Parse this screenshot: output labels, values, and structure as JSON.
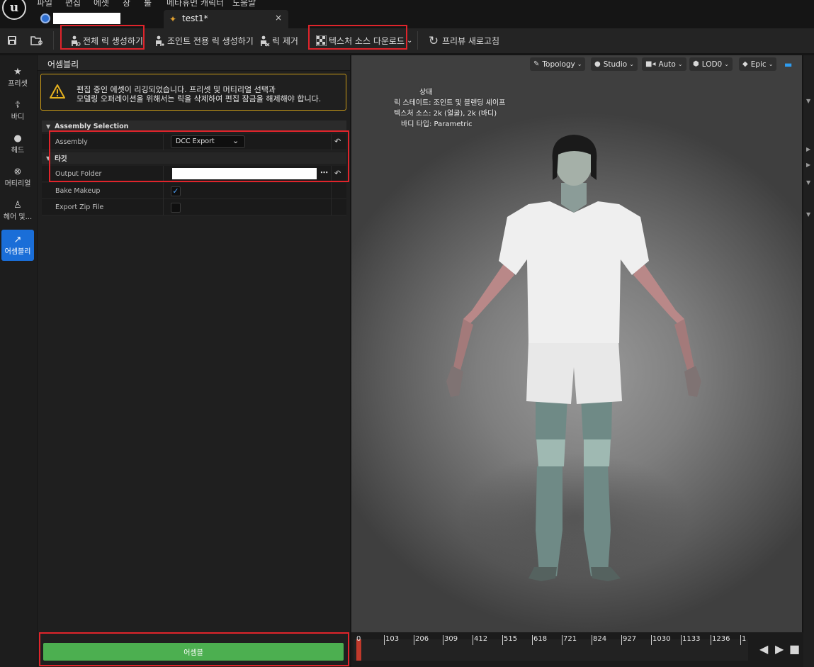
{
  "menu": {
    "items": [
      "파일",
      "편집",
      "에셋",
      "창",
      "툴",
      "메타휴먼 캐릭터",
      "도움말"
    ]
  },
  "tabs": {
    "document_label": "test1*",
    "close_glyph": "×"
  },
  "toolbar": {
    "rig_full_label": "전체 릭 생성하기",
    "rig_joint_label": "조인트 전용 릭 생성하기",
    "rig_remove_label": "릭 제거",
    "texture_download_label": "텍스처 소스 다운로드",
    "preview_refresh_label": "프리뷰 새로고침"
  },
  "leftnav": {
    "items": [
      {
        "label": "프리셋",
        "icon": "star-icon",
        "active": false
      },
      {
        "label": "바디",
        "icon": "body-icon",
        "active": false
      },
      {
        "label": "헤드",
        "icon": "head-icon",
        "active": false
      },
      {
        "label": "머티리얼",
        "icon": "material-icon",
        "active": false
      },
      {
        "label": "헤어 및...",
        "icon": "hair-icon",
        "active": false
      },
      {
        "label": "어셈블리",
        "icon": "hammer-icon",
        "active": true
      }
    ],
    "active_color": "#1a6ed8"
  },
  "panel": {
    "title": "어셈블리",
    "warning_line1": "편집 중인 에셋이 리깅되었습니다. 프리셋 및 머티리얼 선택과",
    "warning_line2": "모델링 오퍼레이션을 위해서는 릭을 삭제하여 편집 잠금을 해제해야 합니다.",
    "warning_color": "#c99a17",
    "section_assembly": "Assembly Selection",
    "section_target": "타깃",
    "assembly_label": "Assembly",
    "assembly_value": "DCC Export",
    "output_folder_label": "Output Folder",
    "bake_makeup_label": "Bake Makeup",
    "bake_makeup_checked": true,
    "export_zip_label": "Export Zip File",
    "export_zip_checked": false,
    "assemble_button": "어셈블",
    "assemble_color": "#4caf50"
  },
  "viewport": {
    "toolbar": [
      "Topology",
      "Studio",
      "Auto",
      "LOD0",
      "Epic"
    ],
    "status_title": "상태",
    "status_rig": "릭 스테이트: 조인트 및 블렌딩 셰이프",
    "status_texture": "텍스처 소스: 2k (얼굴), 2k (바디)",
    "status_body": "바디 타입: Parametric"
  },
  "timeline": {
    "ticks": [
      "0",
      "103",
      "206",
      "309",
      "412",
      "515",
      "618",
      "721",
      "824",
      "927",
      "1030",
      "1133",
      "1236",
      "1"
    ]
  },
  "highlight_color": "#e0242b"
}
